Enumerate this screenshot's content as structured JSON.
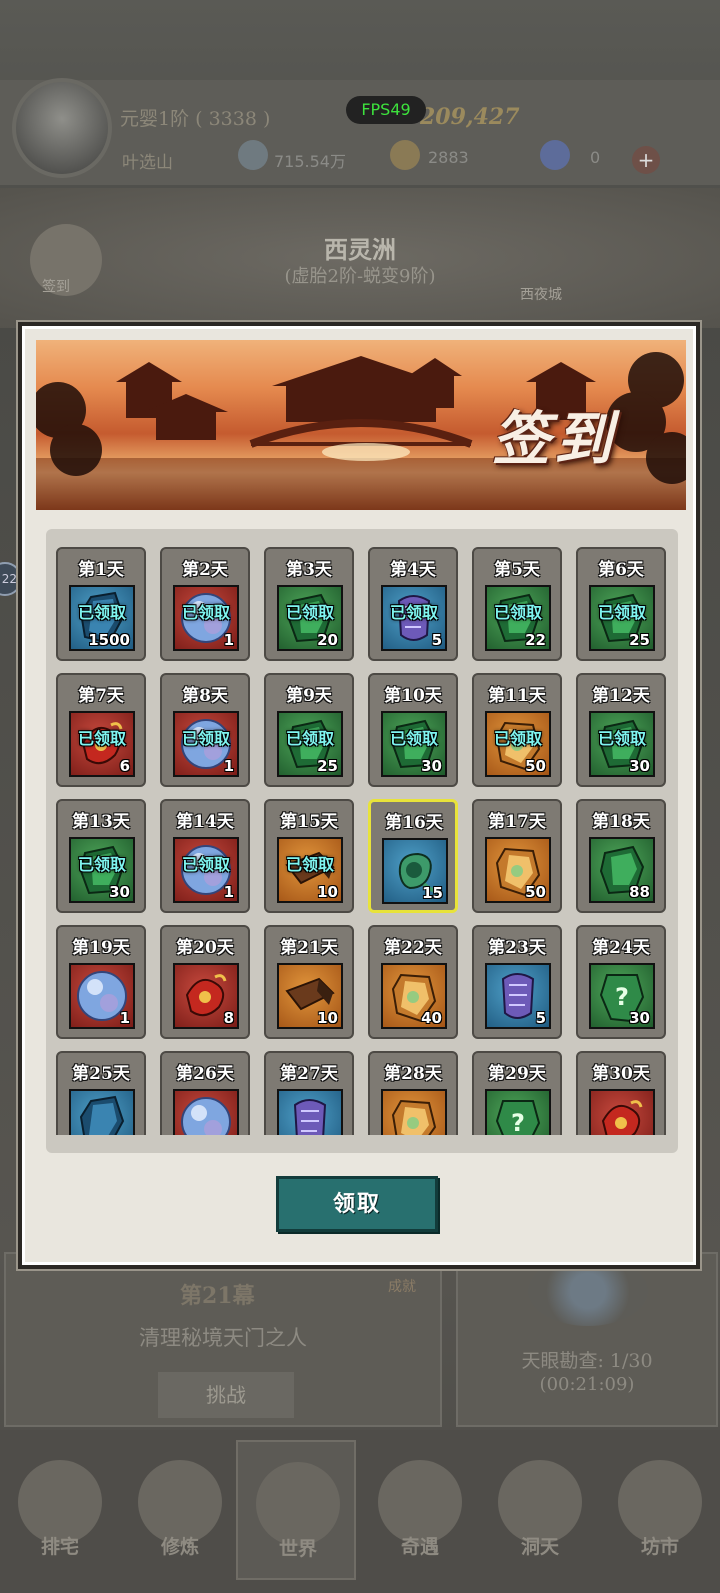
{
  "hud": {
    "fps": "FPS49",
    "realm": "元婴1阶 ( 3338 )",
    "player_name": "叶选山",
    "power": "209,427",
    "spirit_stones": "715.54万",
    "jade": "2883",
    "crystals": "0",
    "plus": "+"
  },
  "map": {
    "region_name": "西灵洲",
    "region_range": "(虚胎2阶-蜕变9阶)",
    "left_button": "签到",
    "right_button": "西夜城",
    "side_badge": "22"
  },
  "stage": {
    "title": "第21幕",
    "description": "清理秘境天门之人",
    "challenge": "挑战",
    "achievement": "成就"
  },
  "heaven_eye": {
    "progress": "天眼勘查: 1/30",
    "timer": "(00:21:09)"
  },
  "nav": [
    "排宅",
    "修炼",
    "世界",
    "奇遇",
    "洞天",
    "坊市"
  ],
  "signin": {
    "title": "签到",
    "claimed_label": "已领取",
    "claim_button": "领取",
    "today": 16,
    "days": [
      {
        "label": "第1天",
        "color": "blue",
        "icon": "crystal-shard-icon",
        "qty": "1500",
        "claimed": true
      },
      {
        "label": "第2天",
        "color": "red",
        "icon": "pearl-orb-icon",
        "qty": "1",
        "claimed": true
      },
      {
        "label": "第3天",
        "color": "green",
        "icon": "jade-leaf-icon",
        "qty": "20",
        "claimed": true
      },
      {
        "label": "第4天",
        "color": "blue",
        "icon": "scroll-icon",
        "qty": "5",
        "claimed": true
      },
      {
        "label": "第5天",
        "color": "green",
        "icon": "jade-leaf-icon",
        "qty": "22",
        "claimed": true
      },
      {
        "label": "第6天",
        "color": "green",
        "icon": "jade-leaf-icon",
        "qty": "25",
        "claimed": true
      },
      {
        "label": "第7天",
        "color": "red",
        "icon": "talisman-icon",
        "qty": "6",
        "claimed": true
      },
      {
        "label": "第8天",
        "color": "red",
        "icon": "pearl-orb-icon",
        "qty": "1",
        "claimed": true
      },
      {
        "label": "第9天",
        "color": "green",
        "icon": "jade-leaf-icon",
        "qty": "25",
        "claimed": true
      },
      {
        "label": "第10天",
        "color": "green",
        "icon": "jade-leaf-icon",
        "qty": "30",
        "claimed": true
      },
      {
        "label": "第11天",
        "color": "orange",
        "icon": "amber-stone-icon",
        "qty": "50",
        "claimed": true
      },
      {
        "label": "第12天",
        "color": "green",
        "icon": "jade-leaf-icon",
        "qty": "30",
        "claimed": true
      },
      {
        "label": "第13天",
        "color": "green",
        "icon": "jade-leaf-icon",
        "qty": "30",
        "claimed": true
      },
      {
        "label": "第14天",
        "color": "red",
        "icon": "pearl-orb-icon",
        "qty": "1",
        "claimed": true
      },
      {
        "label": "第15天",
        "color": "orange",
        "icon": "brush-pen-icon",
        "qty": "10",
        "claimed": true
      },
      {
        "label": "第16天",
        "color": "blue",
        "icon": "jade-pendant-icon",
        "qty": "15",
        "claimed": false
      },
      {
        "label": "第17天",
        "color": "orange",
        "icon": "amber-stone-icon",
        "qty": "50",
        "claimed": false
      },
      {
        "label": "第18天",
        "color": "green",
        "icon": "jade-leaf-icon",
        "qty": "88",
        "claimed": false
      },
      {
        "label": "第19天",
        "color": "red",
        "icon": "pearl-orb-icon",
        "qty": "1",
        "claimed": false
      },
      {
        "label": "第20天",
        "color": "red",
        "icon": "talisman-icon",
        "qty": "8",
        "claimed": false
      },
      {
        "label": "第21天",
        "color": "orange",
        "icon": "brush-pen-icon",
        "qty": "10",
        "claimed": false
      },
      {
        "label": "第22天",
        "color": "orange",
        "icon": "amber-stone-icon",
        "qty": "40",
        "claimed": false
      },
      {
        "label": "第23天",
        "color": "blue",
        "icon": "scroll-icon",
        "qty": "5",
        "claimed": false
      },
      {
        "label": "第24天",
        "color": "green",
        "icon": "mystery-jade-icon",
        "qty": "30",
        "claimed": false
      },
      {
        "label": "第25天",
        "color": "blue",
        "icon": "crystal-shard-icon",
        "qty": "",
        "claimed": false
      },
      {
        "label": "第26天",
        "color": "red",
        "icon": "pearl-orb-icon",
        "qty": "",
        "claimed": false
      },
      {
        "label": "第27天",
        "color": "blue",
        "icon": "scroll-icon",
        "qty": "",
        "claimed": false
      },
      {
        "label": "第28天",
        "color": "orange",
        "icon": "amber-stone-icon",
        "qty": "",
        "claimed": false
      },
      {
        "label": "第29天",
        "color": "green",
        "icon": "mystery-jade-icon",
        "qty": "",
        "claimed": false
      },
      {
        "label": "第30天",
        "color": "red",
        "icon": "talisman-icon",
        "qty": "",
        "claimed": false
      }
    ]
  }
}
